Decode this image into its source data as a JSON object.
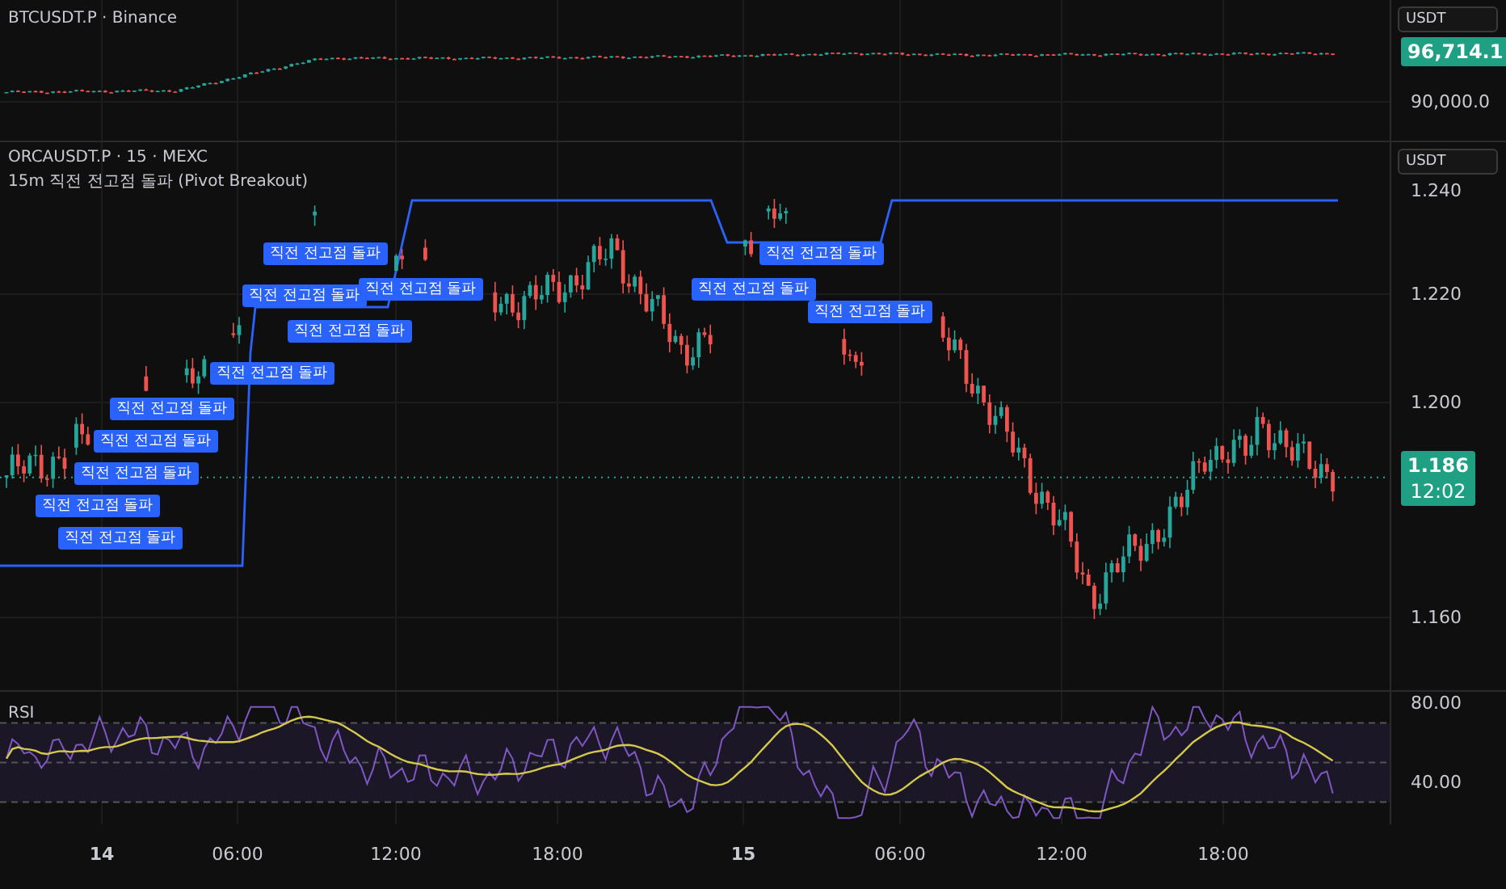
{
  "top_pane": {
    "legend": "BTCUSDT.P · Binance",
    "currency_button": "USDT",
    "last_price": "96,714.1",
    "axis_labels": [
      "90,000.0"
    ]
  },
  "main_pane": {
    "legend": "ORCAUSDT.P · 15 · MEXC",
    "indicator": "15m 직전 전고점 돌파 (Pivot Breakout)",
    "currency_button": "USDT",
    "axis_labels": [
      "1.240",
      "1.220",
      "1.200",
      "1.160"
    ],
    "last_price": "1.186",
    "countdown": "12:02",
    "signals": [
      {
        "text": "직전 전고점 돌파"
      },
      {
        "text": "직전 전고점 돌파"
      },
      {
        "text": "직전 전고점 돌파"
      },
      {
        "text": "직전 전고점 돌파"
      },
      {
        "text": "직전 전고점 돌파"
      },
      {
        "text": "직전 전고점 돌파"
      },
      {
        "text": "직전 전고점 돌파"
      },
      {
        "text": "직전 전고점 돌파"
      },
      {
        "text": "직전 전고점 돌파"
      },
      {
        "text": "직전 전고점 돌파"
      },
      {
        "text": "직전 전고점 돌파"
      },
      {
        "text": "직전 전고점 돌파"
      },
      {
        "text": "직전 전고점 돌파"
      }
    ]
  },
  "rsi_pane": {
    "legend": "RSI",
    "axis_labels": [
      "80.00",
      "40.00"
    ]
  },
  "time_axis": [
    {
      "label": "14",
      "major": true
    },
    {
      "label": "06:00",
      "major": false
    },
    {
      "label": "12:00",
      "major": false
    },
    {
      "label": "18:00",
      "major": false
    },
    {
      "label": "15",
      "major": true
    },
    {
      "label": "06:00",
      "major": false
    },
    {
      "label": "12:00",
      "major": false
    },
    {
      "label": "18:00",
      "major": false
    }
  ]
}
